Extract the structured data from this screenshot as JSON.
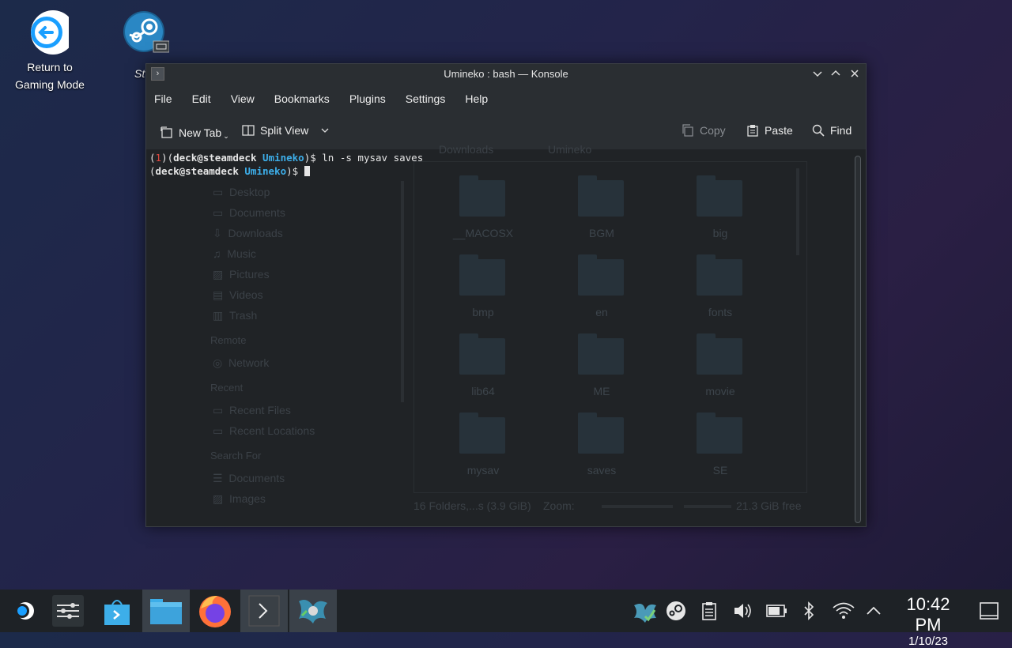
{
  "desktop": {
    "icons": [
      {
        "label": "Return to\nGaming Mode"
      },
      {
        "label": "St"
      }
    ]
  },
  "window": {
    "title": "Umineko : bash — Konsole",
    "menu": [
      "File",
      "Edit",
      "View",
      "Bookmarks",
      "Plugins",
      "Settings",
      "Help"
    ],
    "toolbar": {
      "new_tab": "New Tab",
      "split_view": "Split View",
      "copy": "Copy",
      "paste": "Paste",
      "find": "Find"
    }
  },
  "terminal": {
    "line1": {
      "exit_open": "(",
      "exit_code": "1",
      "exit_close": ")(",
      "user": "deck@steamdeck",
      "dir": "Umineko",
      "prompt_end": ")$ ",
      "command": "ln -s mysav saves"
    },
    "line2": {
      "open": "(",
      "user": "deck@steamdeck",
      "dir": "Umineko",
      "prompt_end": ")$ "
    }
  },
  "background_filemanager": {
    "tabs": [
      "Downloads",
      "Umineko"
    ],
    "places": [
      "Desktop",
      "Documents",
      "Downloads",
      "Music",
      "Pictures",
      "Videos",
      "Trash"
    ],
    "remote_header": "Remote",
    "remote": [
      "Network"
    ],
    "recent_header": "Recent",
    "recent": [
      "Recent Files",
      "Recent Locations"
    ],
    "search_header": "Search For",
    "search": [
      "Documents",
      "Images"
    ],
    "folders": [
      "__MACOSX",
      "BGM",
      "big",
      "bmp",
      "en",
      "fonts",
      "lib64",
      "ME",
      "movie",
      "mysav",
      "saves",
      "SE"
    ],
    "status": "16 Folders,...s (3.9 GiB)",
    "zoom_label": "Zoom:",
    "free": "21.3 GiB free"
  },
  "taskbar": {
    "clock_time": "10:42 PM",
    "clock_date": "1/10/23"
  },
  "colors": {
    "accent": "#3daee9",
    "error": "#e0483f",
    "window_bg": "#202326",
    "taskbar_bg": "#1e2226"
  }
}
